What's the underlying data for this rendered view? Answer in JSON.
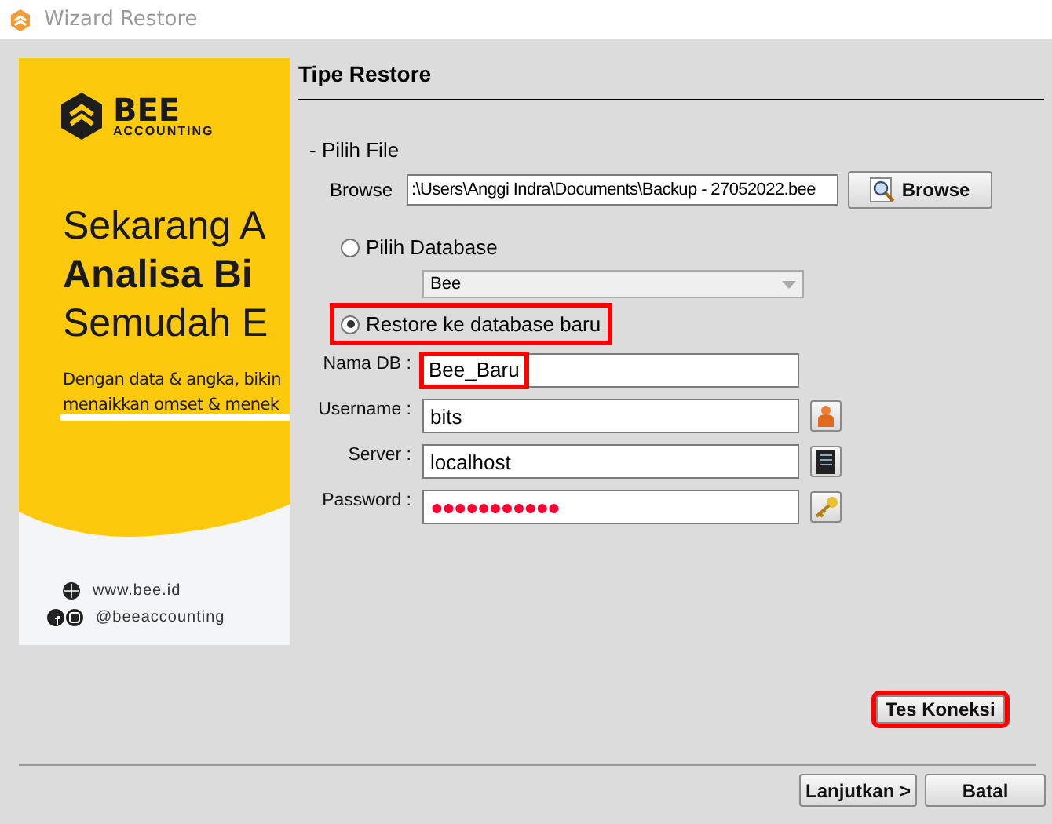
{
  "window": {
    "title": "Wizard Restore"
  },
  "banner": {
    "brand": "BEE",
    "brand_sub": "ACCOUNTING",
    "headline": [
      "Sekarang A",
      "Analisa Bi",
      "Semudah E"
    ],
    "body": [
      "Dengan data & angka, bikin",
      "menaikkan omset & menek"
    ],
    "website": "www.bee.id",
    "social": "@beeaccounting"
  },
  "section_title": "Tipe Restore",
  "file_group": {
    "label": "- Pilih File",
    "browse_label": "Browse",
    "path": ":\\Users\\Anggi Indra\\Documents\\Backup - 27052022.bee",
    "browse_button": "Browse"
  },
  "options": [
    {
      "label": "Pilih Database",
      "selected": false,
      "highlighted": false,
      "dropdown": "Bee"
    },
    {
      "label": "Restore ke database baru",
      "selected": true,
      "highlighted": true
    }
  ],
  "fields": [
    {
      "label": "Nama DB :",
      "value": "Bee_Baru",
      "highlighted": true,
      "kind": "plain"
    },
    {
      "label": "Username :",
      "value": "bits",
      "highlighted": false,
      "kind": "user"
    },
    {
      "label": "Server :",
      "value": "localhost",
      "highlighted": false,
      "kind": "server"
    },
    {
      "label": "Password :",
      "value": "●●●●●●●●●●●",
      "highlighted": false,
      "kind": "password"
    }
  ],
  "test_button": {
    "label": "Tes Koneksi",
    "highlighted": true
  },
  "footer_buttons": [
    "Lanjutkan >",
    "Batal"
  ]
}
